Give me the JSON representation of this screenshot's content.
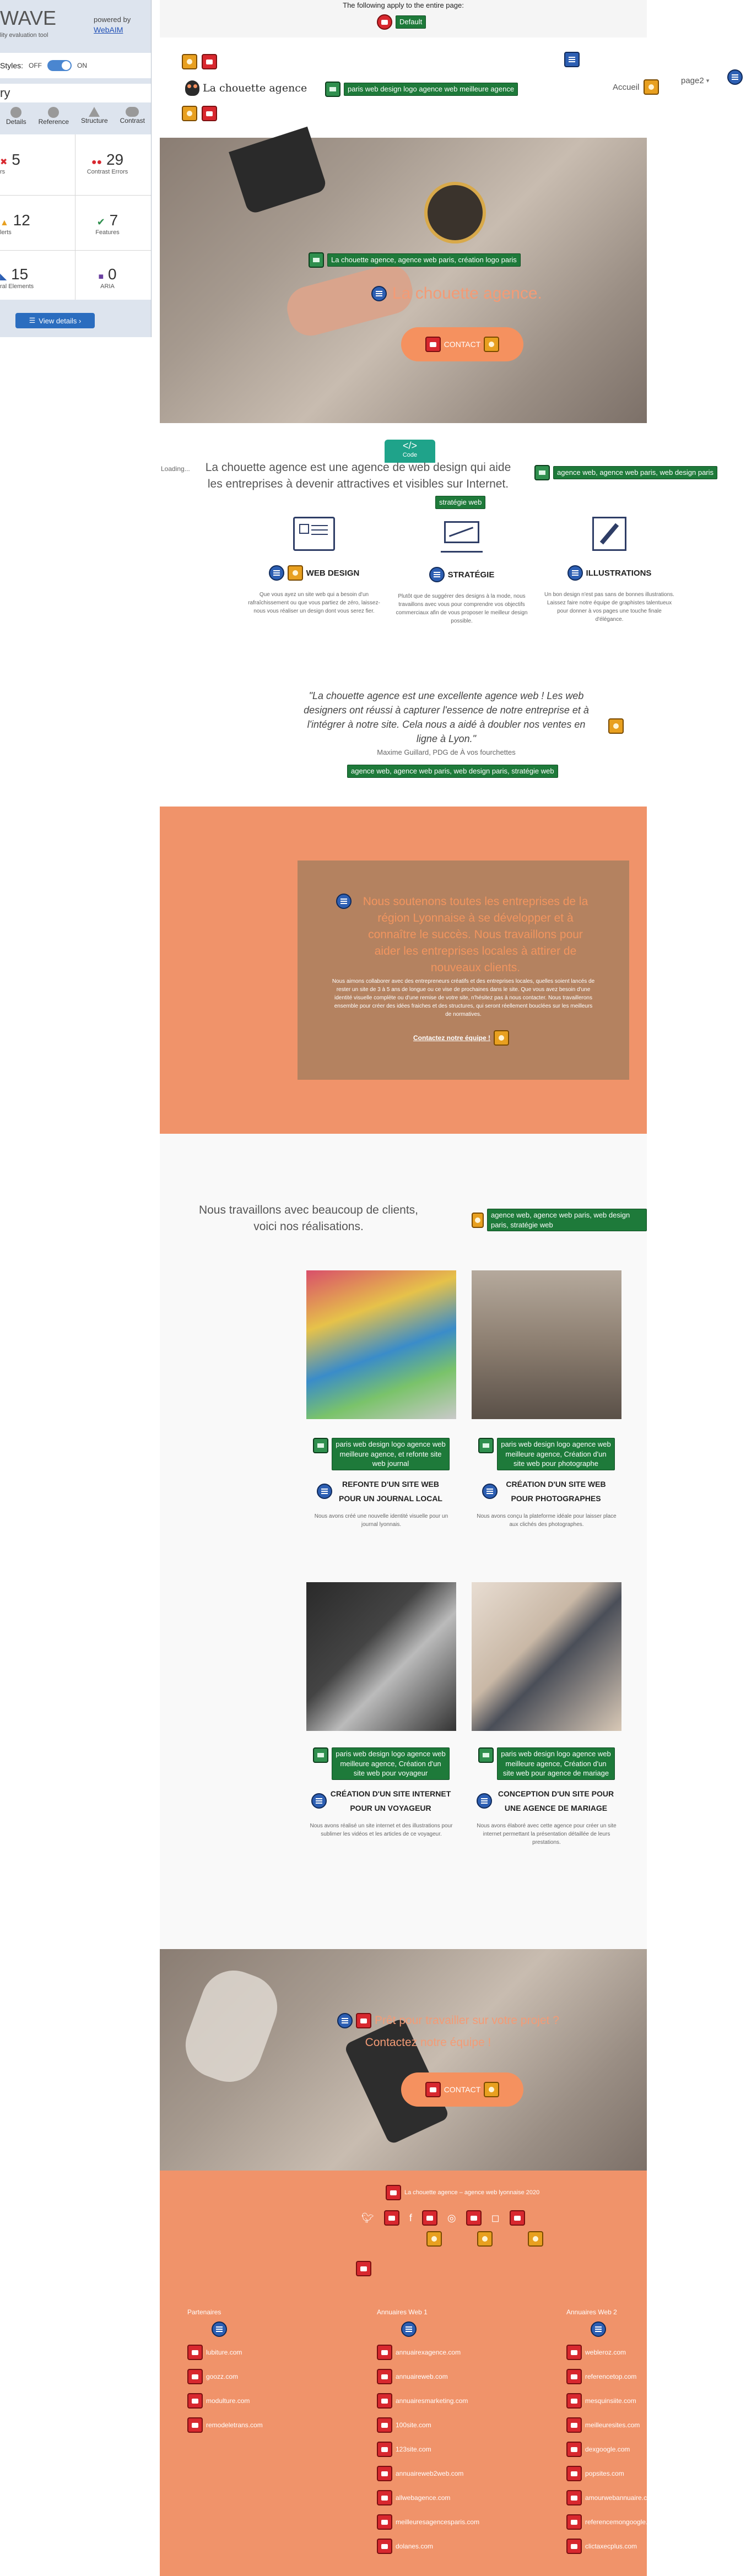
{
  "wave_top": {
    "notice": "The following apply to the entire page:",
    "lang_label": "Default"
  },
  "header": {
    "logo_text": "La chouette agence",
    "logo_alt": "paris web design logo agence web meilleure agence",
    "nav": [
      "Accueil",
      "page2"
    ]
  },
  "hero": {
    "alt_text": "La chouette agence, agence web paris, création logo paris",
    "title": "La chouette agence.",
    "cta": "CONTACT"
  },
  "wave_panel": {
    "title": "WAVE",
    "subtitle": "lity evaluation tool",
    "powered_by": "powered by",
    "powered_link": "WebAIM",
    "styles_label": "Styles:",
    "off": "OFF",
    "on": "ON",
    "section": "ry",
    "tabs": [
      "Details",
      "Reference",
      "Structure",
      "Contrast"
    ],
    "stats": [
      {
        "count": "5",
        "label": "rs",
        "color": "#d8282f"
      },
      {
        "count": "29",
        "label": "Contrast Errors",
        "color": "#d8282f"
      },
      {
        "count": "12",
        "label": "lerts",
        "color": "#e8a020"
      },
      {
        "count": "7",
        "label": "Features",
        "color": "#2f8f4e"
      },
      {
        "count": "15",
        "label": "ral Elements",
        "color": "#2d5fb3"
      },
      {
        "count": "0",
        "label": "ARIA",
        "color": "#6a3fa0"
      }
    ],
    "view_details": "View details ›"
  },
  "loading_text": "Loading...",
  "code_badge": "Code",
  "intro": {
    "text_line1": "La chouette agence est une agence de web design qui aide",
    "text_line2": "les entreprises à devenir attractives et visibles sur Internet.",
    "alt1": "agence web, agence web paris, web design paris",
    "alt2": "stratégie web"
  },
  "services": [
    {
      "title": "WEB DESIGN",
      "text": "Que vous ayez un site web qui a besoin d'un rafraîchissement ou que vous partiez de zéro, laissez-nous vous réaliser un design dont vous serez fier."
    },
    {
      "title": "STRATÉGIE",
      "text": "Plutôt que de suggérer des designs à la mode, nous travaillons avec vous pour comprendre vos objectifs commerciaux afin de vous proposer le meilleur design possible."
    },
    {
      "title": "ILLUSTRATIONS",
      "text": "Un bon design n'est pas sans de bonnes illustrations. Laissez faire notre équipe de graphistes talentueux pour donner à vos pages une touche finale d'élégance."
    }
  ],
  "testimonial": {
    "quote": "\"La chouette agence est une excellente agence web ! Les web designers ont réussi à capturer l'essence de notre entreprise et à l'intégrer à notre site. Cela nous a aidé à doubler nos ventes en ligne à Lyon.\"",
    "author": "Maxime Guillard, PDG de À vos fourchettes",
    "alt": "agence web, agence web paris, web design paris, stratégie web"
  },
  "orange_block": {
    "heading": "Nous soutenons toutes les entreprises de la région Lyonnaise à se développer et à connaître le succès. Nous travaillons pour aider les entreprises locales à attirer de nouveaux clients.",
    "body": "Nous aimons collaborer avec des entrepreneurs créatifs et des entreprises locales, quelles soient lancés de rester un site de 3 à 5 ans de longue ou ce vise de prochaines dans le site. Que vous avez besoin d'une identité visuelle complète ou d'une remise de votre site, n'hésitez pas à nous contacter. Nous travaillerons ensemble pour créer des idées fraiches et des structures, qui seront réellement bouclées sur les meilleurs de normatives.",
    "link": "Contactez notre équipe !"
  },
  "realisations": {
    "intro_line1": "Nous travaillons avec beaucoup de clients,",
    "intro_line2": "voici nos réalisations.",
    "alt": "agence web, agence web paris, web design paris, stratégie web",
    "items": [
      {
        "alt": "paris web design logo agence web meilleure agence, et refonte site web journal",
        "title": "REFONTE D'UN SITE WEB POUR UN JOURNAL LOCAL",
        "text": "Nous avons créé une nouvelle identité visuelle pour un journal lyonnais."
      },
      {
        "alt": "paris web design logo agence web meilleure agence, Création d'un site web pour photographe",
        "title": "CRÉATION D'UN SITE WEB POUR PHOTOGRAPHES",
        "text": "Nous avons conçu la plateforme idéale pour laisser place aux clichés des photographes."
      },
      {
        "alt": "paris web design logo agence web meilleure agence, Création d'un site web pour voyageur",
        "title": "CRÉATION D'UN SITE INTERNET POUR UN VOYAGEUR",
        "text": "Nous avons réalisé un site internet et des illustrations pour sublimer les vidéos et les articles de ce voyageur."
      },
      {
        "alt": "paris web design logo agence web meilleure agence, Création d'un site web pour agence de mariage",
        "title": "CONCEPTION D'UN SITE POUR UNE AGENCE DE MARIAGE",
        "text": "Nous avons élaboré avec cette agence pour créer un site internet permettant la présentation détaillée de leurs prestations."
      }
    ]
  },
  "cta2": {
    "line1": "Prêt pour travailler sur votre projet ?",
    "line2": "Contactez notre équipe !",
    "button": "CONTACT"
  },
  "footer": {
    "copyright": "La chouette agence – agence web lyonnaise 2020",
    "columns": [
      {
        "title": "Partenaires",
        "links": [
          "lubiture.com",
          "goozz.com",
          "modulture.com",
          "remodeletrans.com"
        ]
      },
      {
        "title": "Annuaires Web 1",
        "links": [
          "annuairexagence.com",
          "annuaireweb.com",
          "annuairesmarketing.com",
          "100site.com",
          "123site.com",
          "annuaireweb2web.com",
          "allwebagence.com",
          "meilleuresagencesparis.com",
          "dolanes.com"
        ]
      },
      {
        "title": "Annuaires Web 2",
        "links": [
          "webleroz.com",
          "referencetop.com",
          "mesquinsiite.com",
          "meilleuresites.com",
          "dexgoogle.com",
          "popsites.com",
          "amourwebannuaire.com",
          "referencemongoogle.com",
          "clictaxecplus.com"
        ]
      }
    ]
  },
  "colors": {
    "orange": "#f0936a",
    "cta": "#f5915f",
    "wave_green": "#1e7a3a",
    "wave_red": "#d8282f",
    "panel_bg": "#dde4ee"
  }
}
